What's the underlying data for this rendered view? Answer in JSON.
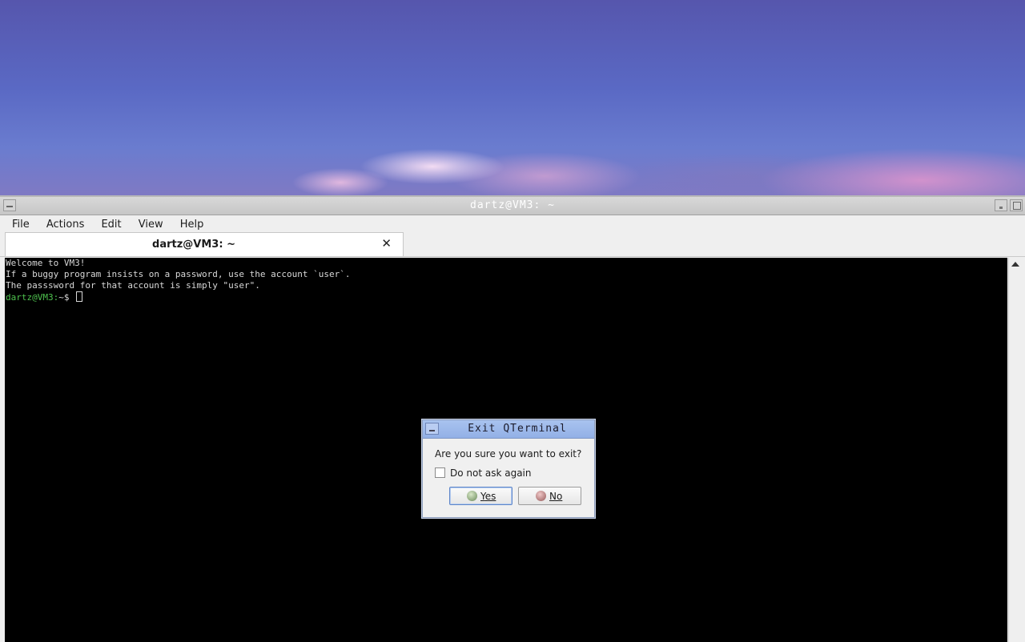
{
  "window": {
    "title": "dartz@VM3: ~"
  },
  "menubar": {
    "items": [
      "File",
      "Actions",
      "Edit",
      "View",
      "Help"
    ]
  },
  "tabs": [
    {
      "label": "dartz@VM3: ~",
      "close_icon": "close-x-icon"
    }
  ],
  "terminal": {
    "lines": [
      "Welcome to VM3!",
      "If a buggy program insists on a password, use the account `user`.",
      "The passsword for that account is simply \"user\"."
    ],
    "prompt_user": "dartz@VM3:",
    "prompt_rest": "~$ "
  },
  "dialog": {
    "title": "Exit QTerminal",
    "question": "Are you sure you want to exit?",
    "checkbox_label": "Do not ask again",
    "checkbox_checked": false,
    "yes_label_mnemonic": "Y",
    "yes_label_rest": "es",
    "no_label_mnemonic": "N",
    "no_label_rest": "o"
  },
  "colors": {
    "terminal_bg": "#000000",
    "prompt_green": "#4ec24e",
    "dialog_title_bg": "#a9c3ef"
  }
}
